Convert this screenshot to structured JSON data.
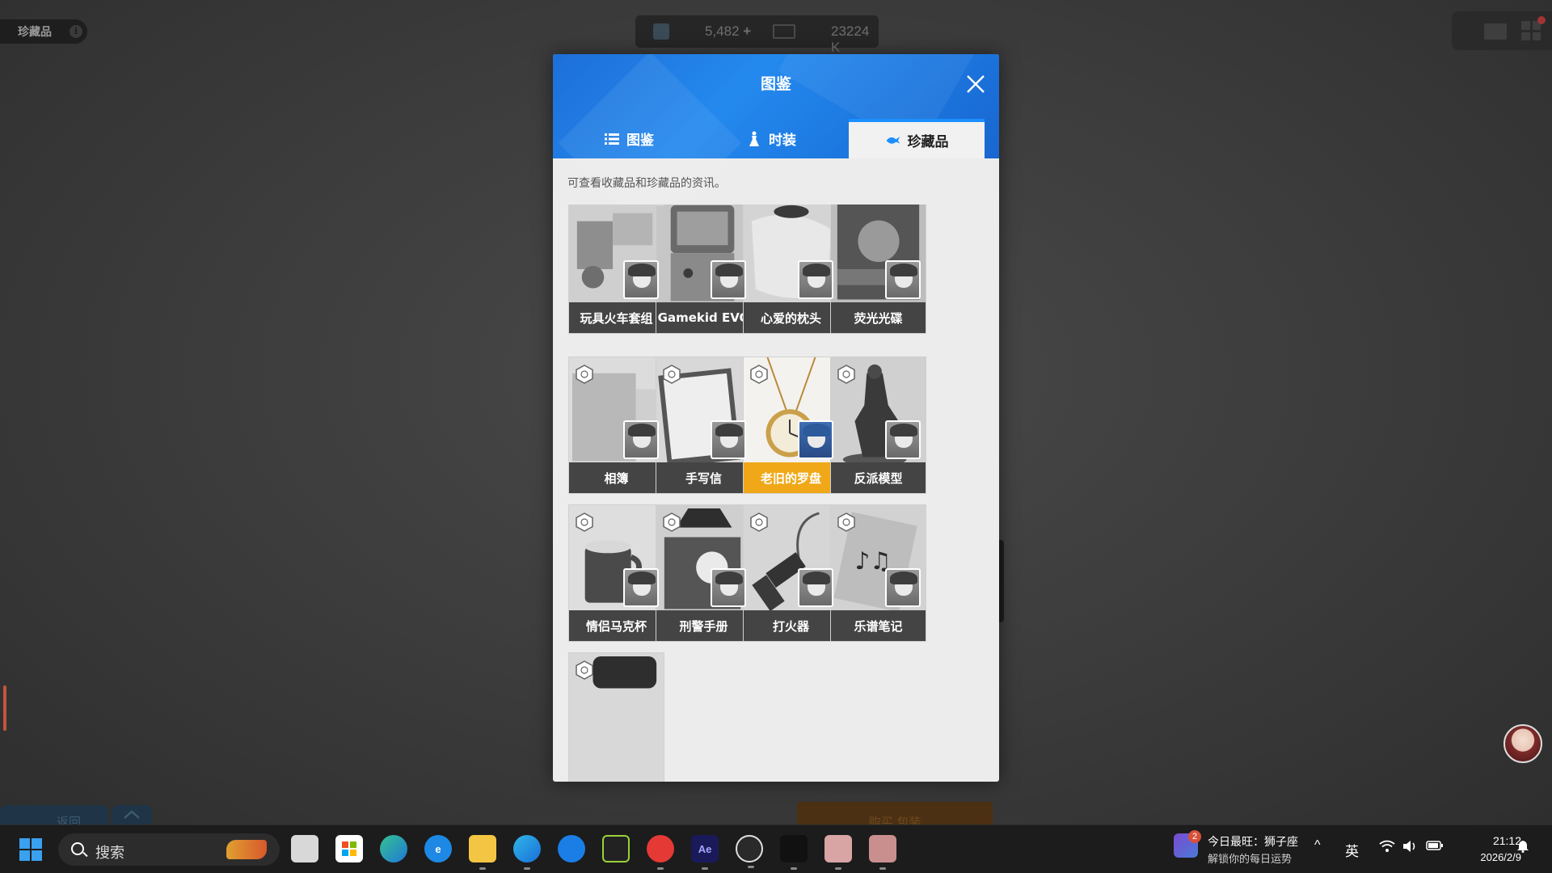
{
  "game": {
    "top_left_label": "珍藏品",
    "currency": {
      "value1": "5,482",
      "plus": "+",
      "value2": "23224 K"
    },
    "bottom_left_button": "返回",
    "bottom_right_button": "购买 包装"
  },
  "modal": {
    "title": "图鉴",
    "tabs": [
      {
        "label": "图鉴",
        "icon": "list-icon",
        "active": false
      },
      {
        "label": "时装",
        "icon": "dress-icon",
        "active": false
      },
      {
        "label": "珍藏品",
        "icon": "bird-icon",
        "active": true
      }
    ],
    "description": "可查看收藏品和珍藏品的资讯。",
    "cards": [
      {
        "name": "玩具火车套组"
      },
      {
        "name": "Gamekid EVO"
      },
      {
        "name": "心爱的枕头"
      },
      {
        "name": "荧光光碟"
      },
      {
        "name": "相簿"
      },
      {
        "name": "手写信"
      },
      {
        "name": "老旧的罗盘",
        "highlighted": true
      },
      {
        "name": "反派模型"
      },
      {
        "name": "情侣马克杯"
      },
      {
        "name": "刑警手册"
      },
      {
        "name": "打火器"
      },
      {
        "name": "乐谱笔记"
      },
      {
        "name": ""
      }
    ]
  },
  "taskbar": {
    "search_placeholder": "搜索",
    "apps": [
      "task-view-icon",
      "store-icon",
      "edge-icon",
      "ie-icon",
      "file-explorer-icon",
      "edge-ai-icon",
      "maps-icon",
      "nvidia-icon",
      "netease-music-icon",
      "after-effects-icon",
      "media-player-icon",
      "terminal-icon",
      "game-icon-1",
      "game-icon-2"
    ],
    "after_effects_label": "Ae",
    "notification_badge": "2",
    "notification_title": "今日最旺：狮子座",
    "notification_subtitle": "解锁你的每日运势",
    "chevron": "^",
    "language": "英",
    "time": "21:12",
    "date": "2026/2/9"
  },
  "colors": {
    "header_blue": "#1c78e0",
    "active_tab_accent": "#1a8fff",
    "highlight_card": "#f0a818"
  }
}
